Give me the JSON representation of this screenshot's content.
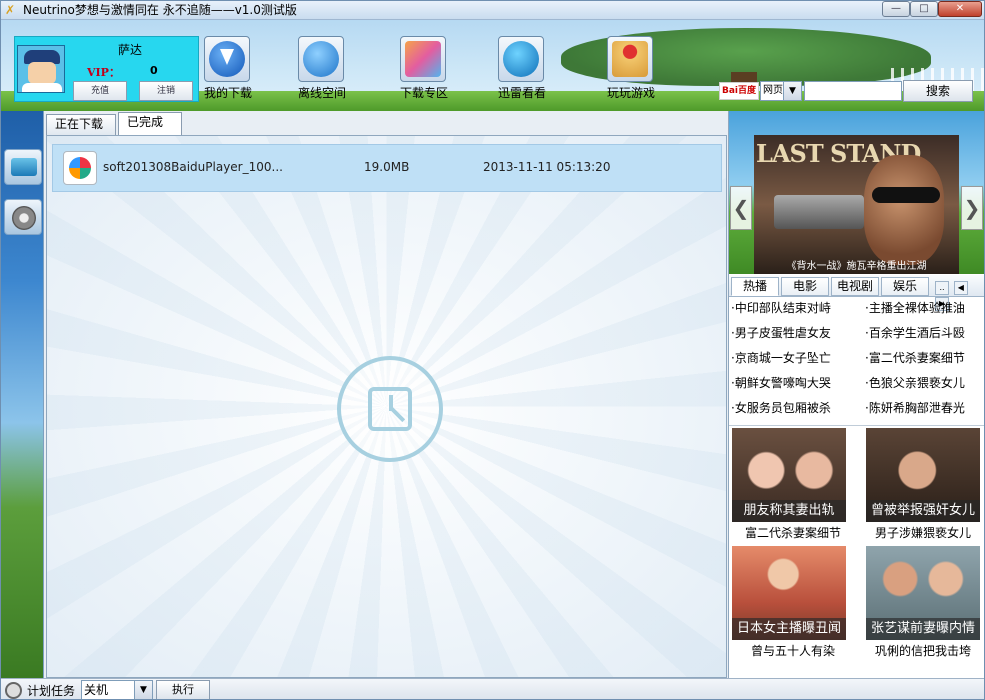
{
  "window": {
    "title": "Neutrino梦想与激情同在  永不追随——v1.0测试版",
    "controls": {
      "minimize": "—",
      "maximize": "□",
      "close": "✕"
    }
  },
  "user": {
    "name": "萨达",
    "vip_label": "VIP：",
    "vip_value": "0",
    "recharge_label": "充值",
    "logout_label": "注销"
  },
  "nav": [
    {
      "label": "我的下载",
      "icon": "download-arrow-icon"
    },
    {
      "label": "离线空间",
      "icon": "cloud-icon"
    },
    {
      "label": "下载专区",
      "icon": "cube-icon"
    },
    {
      "label": "迅雷看看",
      "icon": "play-icon"
    },
    {
      "label": "玩玩游戏",
      "icon": "joystick-icon"
    }
  ],
  "search": {
    "logo": "Bai百度",
    "type": "网页",
    "query": "",
    "button": "搜索"
  },
  "tabs": {
    "downloading": "正在下载",
    "completed": "已完成",
    "active": "completed"
  },
  "files": [
    {
      "name": "soft201308BaiduPlayer_100...",
      "size": "19.0MB",
      "date": "2013-11-11 05:13:20"
    }
  ],
  "banner": {
    "poster_title": "LAST STAND",
    "caption": "《背水一战》施瓦辛格重出江湖",
    "prev": "❮",
    "next": "❯"
  },
  "categories": [
    "热播",
    "电影",
    "电视剧",
    "娱乐"
  ],
  "category_scroll": {
    "more": "..",
    "left": "◀",
    "right": "▶"
  },
  "news": [
    [
      "·中印部队结束对峙",
      "·主播全裸体验推油"
    ],
    [
      "·男子皮蛋牲虐女友",
      "·百余学生酒后斗殴"
    ],
    [
      "·京商城一女子坠亡",
      "·富二代杀妻案细节"
    ],
    [
      "·朝鲜女警嚎啕大哭",
      "·色狼父亲猥亵女儿"
    ],
    [
      "·女服务员包厢被杀",
      "·陈妍希胸部泄春光"
    ]
  ],
  "thumbs": [
    {
      "overlay": "朋友称其妻出轨",
      "caption": "富二代杀妻案细节"
    },
    {
      "overlay": "曾被举报强奸女儿",
      "caption": "男子涉嫌猥亵女儿"
    },
    {
      "overlay": "日本女主播曝丑闻",
      "caption": "曾与五十人有染"
    },
    {
      "overlay": "张艺谋前妻曝内情",
      "caption": "巩俐的信把我击垮"
    }
  ],
  "status": {
    "schedule_label": "计划任务",
    "schedule_value": "关机",
    "execute_label": "执行"
  }
}
